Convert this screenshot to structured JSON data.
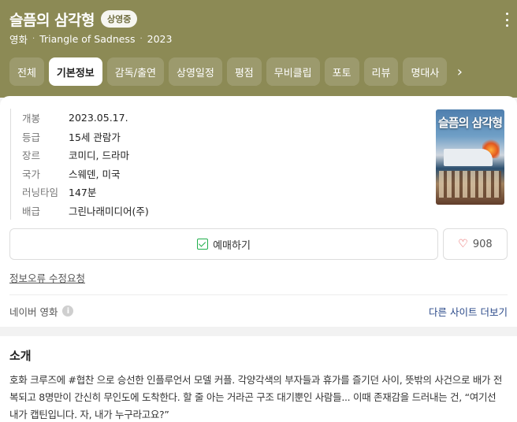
{
  "header": {
    "title": "슬픔의 삼각형",
    "badge": "상영중",
    "meta": [
      "영화",
      "Triangle of Sadness",
      "2023"
    ],
    "colors": {
      "background": "#8c8a55"
    }
  },
  "tabs": [
    {
      "label": "전체"
    },
    {
      "label": "기본정보",
      "active": true
    },
    {
      "label": "감독/출연"
    },
    {
      "label": "상영일정"
    },
    {
      "label": "평점"
    },
    {
      "label": "무비클립"
    },
    {
      "label": "포토"
    },
    {
      "label": "리뷰"
    },
    {
      "label": "명대사"
    }
  ],
  "info": [
    {
      "key": "개봉",
      "value": "2023.05.17."
    },
    {
      "key": "등급",
      "value": "15세 관람가"
    },
    {
      "key": "장르",
      "value": "코미디, 드라마"
    },
    {
      "key": "국가",
      "value": "스웨덴, 미국"
    },
    {
      "key": "러닝타임",
      "value": "147분"
    },
    {
      "key": "배급",
      "value": "그린나래미디어(주)"
    }
  ],
  "poster": {
    "title": "슬픔의 삼각형"
  },
  "actions": {
    "reserve_label": "예매하기",
    "like_count": "908"
  },
  "report_link": "정보오류 수정요청",
  "source": {
    "name": "네이버 영화",
    "more_link": "다른 사이트 더보기"
  },
  "intro": {
    "title": "소개",
    "body": "호화 크루즈에 #협찬 으로 승선한 인플루언서 모델 커플. 각양각색의 부자들과 휴가를 즐기던 사이, 뜻밖의 사건으로 배가 전복되고 8명만이 간신히 무인도에 도착한다. 할 줄 아는 거라곤 구조 대기뿐인 사람들... 이때 존재감을 드러내는 건, “여기선 내가 캡틴입니다. 자, 내가 누구라고요?”"
  }
}
